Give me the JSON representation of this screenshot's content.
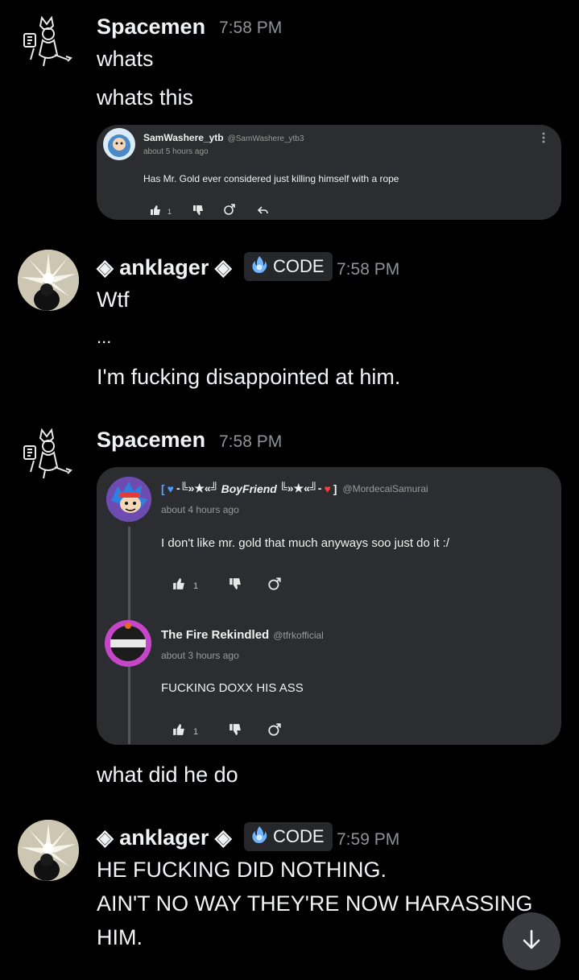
{
  "messages": [
    {
      "author": "Spacemen",
      "time": "7:58 PM",
      "lines": [
        "whats",
        "whats this"
      ],
      "embed": {
        "channel": "SamWashere_ytb",
        "handle": "@SamWashere_ytb3",
        "ago": "about 5 hours ago",
        "text": "Has Mr. Gold ever considered just killing himself with a rope",
        "likes": "1"
      }
    },
    {
      "author": "◈ anklager ◈",
      "tag": "CODE",
      "time": "7:58 PM",
      "lines": [
        "Wtf",
        "...",
        "I'm fucking disappointed at him."
      ]
    },
    {
      "author": "Spacemen",
      "time": "7:58 PM",
      "embed": {
        "comment1": {
          "name": "BoyFriend",
          "name_prefix": "[",
          "name_deco_left": "-╚»★«╝",
          "name_deco_right": "╚»★«╝-",
          "name_suffix": "]",
          "handle": "@MordecaiSamurai",
          "ago": "about 4 hours ago",
          "text": "I don't like mr. gold that much anyways soo just do it :/",
          "likes": "1"
        },
        "comment2": {
          "name": "The Fire Rekindled",
          "handle": "@tfrkofficial",
          "ago": "about 3 hours ago",
          "text": "FUCKING DOXX HIS ASS",
          "likes": "1"
        }
      },
      "lines": [
        "what did he do"
      ]
    },
    {
      "author": "◈ anklager ◈",
      "tag": "CODE",
      "time": "7:59 PM",
      "lines": [
        "HE FUCKING DID NOTHING.",
        "AIN'T NO WAY THEY'RE NOW HARASSING",
        "HIM."
      ]
    }
  ],
  "colors": {
    "background": "#000000",
    "card": "#2c2d30",
    "tag_bg": "#26272b",
    "timestamp": "#8e9297"
  },
  "icons": [
    "like-icon",
    "dislike-icon",
    "reply-icon",
    "share-icon",
    "more-icon",
    "scroll-down-icon"
  ]
}
